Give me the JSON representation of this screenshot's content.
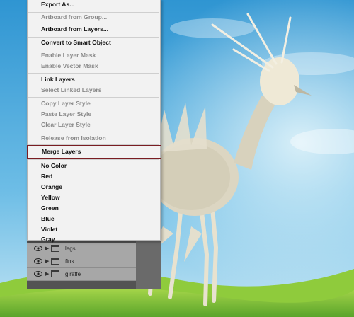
{
  "context_menu": {
    "items": [
      {
        "label": "Export As...",
        "enabled": true
      },
      {
        "label": "Artboard from Group...",
        "enabled": false
      },
      {
        "label": "Artboard from Layers...",
        "enabled": true
      },
      {
        "label": "Convert to Smart Object",
        "enabled": true
      },
      {
        "label": "Enable Layer Mask",
        "enabled": false
      },
      {
        "label": "Enable Vector Mask",
        "enabled": false
      },
      {
        "label": "Link Layers",
        "enabled": true
      },
      {
        "label": "Select Linked Layers",
        "enabled": false
      },
      {
        "label": "Copy Layer Style",
        "enabled": false
      },
      {
        "label": "Paste Layer Style",
        "enabled": false
      },
      {
        "label": "Clear Layer Style",
        "enabled": false
      },
      {
        "label": "Release from Isolation",
        "enabled": false
      },
      {
        "label": "Merge Layers",
        "enabled": true,
        "highlighted": true
      },
      {
        "label": "No Color",
        "enabled": true
      },
      {
        "label": "Red",
        "enabled": true
      },
      {
        "label": "Orange",
        "enabled": true
      },
      {
        "label": "Yellow",
        "enabled": true
      },
      {
        "label": "Green",
        "enabled": true
      },
      {
        "label": "Blue",
        "enabled": true
      },
      {
        "label": "Violet",
        "enabled": true
      },
      {
        "label": "Gray",
        "enabled": true
      }
    ]
  },
  "layers_panel": {
    "rows": [
      {
        "name": "legs",
        "icon": "folder-icon",
        "visible": true
      },
      {
        "name": "fins",
        "icon": "folder-icon",
        "visible": true
      },
      {
        "name": "giraffe",
        "icon": "folder-icon",
        "visible": true
      }
    ]
  },
  "colors": {
    "menu_bg": "#f2f2f2",
    "highlight_border": "#7a1d22",
    "disabled_text": "#8a8a8a",
    "sky": "#3fa6dc",
    "grass": "#7fc43a"
  }
}
